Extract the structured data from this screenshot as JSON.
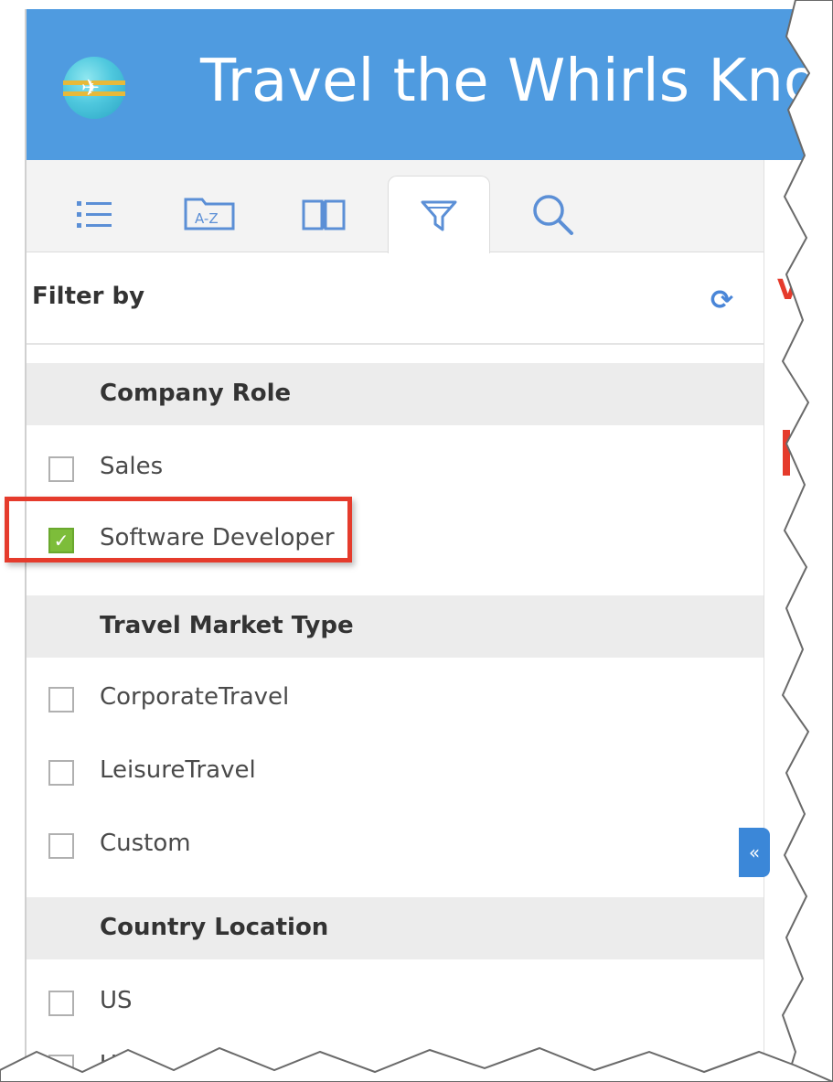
{
  "app": {
    "title": "Travel the Whirls Kno"
  },
  "tabs": [
    {
      "icon": "list-icon",
      "active": false
    },
    {
      "icon": "a-z-index-icon",
      "label": "A-Z",
      "active": false
    },
    {
      "icon": "book-icon",
      "active": false
    },
    {
      "icon": "filter-icon",
      "active": true
    },
    {
      "icon": "search-icon",
      "active": false
    }
  ],
  "filter": {
    "heading": "Filter by",
    "refresh_icon": "refresh-icon",
    "groups": [
      {
        "label": "Company Role",
        "options": [
          {
            "label": "Sales",
            "checked": false
          },
          {
            "label": "Software Developer",
            "checked": true
          }
        ]
      },
      {
        "label": "Travel Market Type",
        "options": [
          {
            "label": "CorporateTravel",
            "checked": false
          },
          {
            "label": "LeisureTravel",
            "checked": false
          },
          {
            "label": "Custom",
            "checked": false
          }
        ]
      },
      {
        "label": "Country Location",
        "options": [
          {
            "label": "US",
            "checked": false
          },
          {
            "label": "UK",
            "checked": false
          }
        ]
      }
    ]
  },
  "collapse": {
    "label": "«"
  },
  "right_pane": {
    "fragment": "V"
  },
  "colors": {
    "header": "#4f9be0",
    "accent": "#5b8fd6",
    "checked": "#7dbd3a",
    "highlight": "#e53b2c"
  }
}
